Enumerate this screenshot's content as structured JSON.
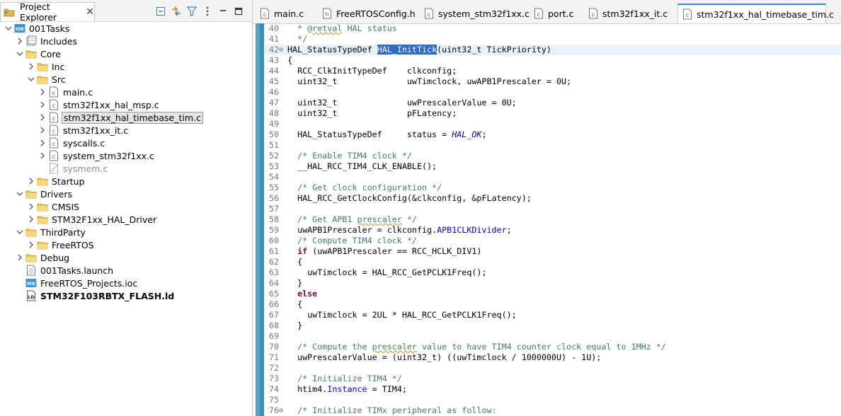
{
  "explorer": {
    "title": "Project Explorer",
    "tree": [
      {
        "label": "001Tasks",
        "depth": 0,
        "chevron": "down",
        "icon": "ide-project-icon"
      },
      {
        "label": "Includes",
        "depth": 1,
        "chevron": "right",
        "icon": "includes-icon"
      },
      {
        "label": "Core",
        "depth": 1,
        "chevron": "down",
        "icon": "folder-icon"
      },
      {
        "label": "Inc",
        "depth": 2,
        "chevron": "right",
        "icon": "folder-icon"
      },
      {
        "label": "Src",
        "depth": 2,
        "chevron": "down",
        "icon": "folder-icon"
      },
      {
        "label": "main.c",
        "depth": 3,
        "chevron": "right",
        "icon": "c-file-icon"
      },
      {
        "label": "stm32f1xx_hal_msp.c",
        "depth": 3,
        "chevron": "right",
        "icon": "c-file-icon"
      },
      {
        "label": "stm32f1xx_hal_timebase_tim.c",
        "depth": 3,
        "chevron": "right",
        "icon": "c-file-icon",
        "selected": true
      },
      {
        "label": "stm32f1xx_it.c",
        "depth": 3,
        "chevron": "right",
        "icon": "c-file-icon"
      },
      {
        "label": "syscalls.c",
        "depth": 3,
        "chevron": "right",
        "icon": "c-file-icon"
      },
      {
        "label": "system_stm32f1xx.c",
        "depth": 3,
        "chevron": "right",
        "icon": "c-file-icon"
      },
      {
        "label": "sysmem.c",
        "depth": 3,
        "chevron": "none",
        "icon": "excluded-c-file-icon",
        "dim": true
      },
      {
        "label": "Startup",
        "depth": 2,
        "chevron": "right",
        "icon": "folder-icon"
      },
      {
        "label": "Drivers",
        "depth": 1,
        "chevron": "down",
        "icon": "folder-icon"
      },
      {
        "label": "CMSIS",
        "depth": 2,
        "chevron": "right",
        "icon": "folder-icon"
      },
      {
        "label": "STM32F1xx_HAL_Driver",
        "depth": 2,
        "chevron": "right",
        "icon": "folder-icon"
      },
      {
        "label": "ThirdParty",
        "depth": 1,
        "chevron": "down",
        "icon": "folder-icon"
      },
      {
        "label": "FreeRTOS",
        "depth": 2,
        "chevron": "right",
        "icon": "folder-icon"
      },
      {
        "label": "Debug",
        "depth": 1,
        "chevron": "right",
        "icon": "folder-icon"
      },
      {
        "label": "001Tasks.launch",
        "depth": 1,
        "chevron": "none",
        "icon": "launch-file-icon"
      },
      {
        "label": "FreeRTOS_Projects.ioc",
        "depth": 1,
        "chevron": "none",
        "icon": "mx-file-icon"
      },
      {
        "label": "STM32F103RBTX_FLASH.ld",
        "depth": 1,
        "chevron": "none",
        "icon": "ld-file-icon",
        "bold": true
      }
    ]
  },
  "editor": {
    "tabs": [
      {
        "label": "main.c",
        "active": false
      },
      {
        "label": "FreeRTOSConfig.h",
        "active": false
      },
      {
        "label": "system_stm32f1xx.c",
        "active": false
      },
      {
        "label": "port.c",
        "active": false
      },
      {
        "label": "stm32f1xx_it.c",
        "active": false
      },
      {
        "label": "stm32f1xx_hal_timebase_tim.c",
        "active": true
      }
    ],
    "lines": [
      {
        "n": "40",
        "segs": [
          [
            "cm",
            "  * @"
          ],
          [
            "cm squig",
            "retval"
          ],
          [
            "cm",
            " HAL status"
          ]
        ]
      },
      {
        "n": "41",
        "segs": [
          [
            "cm",
            "  */"
          ]
        ]
      },
      {
        "n": "42",
        "fold": true,
        "cur": true,
        "segs": [
          [
            "",
            "HAL_StatusTypeDef "
          ],
          [
            "hl",
            "HAL_InitTick"
          ],
          [
            "",
            "(uint32_t TickPriority)"
          ]
        ]
      },
      {
        "n": "43",
        "segs": [
          [
            "",
            "{"
          ]
        ]
      },
      {
        "n": "44",
        "segs": [
          [
            "",
            "  RCC_ClkInitTypeDef    clkconfig;"
          ]
        ]
      },
      {
        "n": "45",
        "segs": [
          [
            "",
            "  uint32_t              uwTimclock, uwAPB1Prescaler = 0U;"
          ]
        ]
      },
      {
        "n": "46",
        "segs": []
      },
      {
        "n": "47",
        "segs": [
          [
            "",
            "  uint32_t              uwPrescalerValue = 0U;"
          ]
        ]
      },
      {
        "n": "48",
        "segs": [
          [
            "",
            "  uint32_t              pFLatency;"
          ]
        ]
      },
      {
        "n": "49",
        "segs": []
      },
      {
        "n": "50",
        "segs": [
          [
            "",
            "  HAL_StatusTypeDef     status = "
          ],
          [
            "it",
            "HAL_OK"
          ],
          [
            "",
            ";"
          ]
        ]
      },
      {
        "n": "51",
        "segs": []
      },
      {
        "n": "52",
        "segs": [
          [
            "cm",
            "  /* Enable TIM4 clock */"
          ]
        ]
      },
      {
        "n": "53",
        "segs": [
          [
            "",
            "  __HAL_RCC_TIM4_CLK_ENABLE();"
          ]
        ]
      },
      {
        "n": "54",
        "segs": []
      },
      {
        "n": "55",
        "segs": [
          [
            "cm",
            "  /* Get clock configuration */"
          ]
        ]
      },
      {
        "n": "56",
        "segs": [
          [
            "",
            "  HAL_RCC_GetClockConfig(&clkconfig, &pFLatency);"
          ]
        ]
      },
      {
        "n": "57",
        "segs": []
      },
      {
        "n": "58",
        "segs": [
          [
            "cm",
            "  /* Get APB1 "
          ],
          [
            "cm squig",
            "prescaler"
          ],
          [
            "cm",
            " */"
          ]
        ]
      },
      {
        "n": "59",
        "segs": [
          [
            "",
            "  uwAPB1Prescaler = clkconfig."
          ],
          [
            "fld",
            "APB1CLKDivider"
          ],
          [
            "",
            ";"
          ]
        ]
      },
      {
        "n": "60",
        "segs": [
          [
            "cm",
            "  /* Compute TIM4 clock */"
          ]
        ]
      },
      {
        "n": "61",
        "segs": [
          [
            "kw",
            "  if"
          ],
          [
            "",
            " (uwAPB1Prescaler == RCC_HCLK_DIV1)"
          ]
        ]
      },
      {
        "n": "62",
        "segs": [
          [
            "",
            "  {"
          ]
        ]
      },
      {
        "n": "63",
        "segs": [
          [
            "",
            "    uwTimclock = HAL_RCC_GetPCLK1Freq();"
          ]
        ]
      },
      {
        "n": "64",
        "segs": [
          [
            "",
            "  }"
          ]
        ]
      },
      {
        "n": "65",
        "segs": [
          [
            "kw",
            "  else"
          ]
        ]
      },
      {
        "n": "66",
        "segs": [
          [
            "",
            "  {"
          ]
        ]
      },
      {
        "n": "67",
        "segs": [
          [
            "",
            "    uwTimclock = 2UL * HAL_RCC_GetPCLK1Freq();"
          ]
        ]
      },
      {
        "n": "68",
        "segs": [
          [
            "",
            "  }"
          ]
        ]
      },
      {
        "n": "69",
        "segs": []
      },
      {
        "n": "70",
        "segs": [
          [
            "cm",
            "  /* Compute the "
          ],
          [
            "cm squig",
            "prescaler"
          ],
          [
            "cm",
            " value to have TIM4 counter clock equal to 1MHz */"
          ]
        ]
      },
      {
        "n": "71",
        "segs": [
          [
            "",
            "  uwPrescalerValue = (uint32_t) ((uwTimclock / 1000000U) - 1U);"
          ]
        ]
      },
      {
        "n": "72",
        "segs": []
      },
      {
        "n": "73",
        "segs": [
          [
            "cm",
            "  /* Initialize TIM4 */"
          ]
        ]
      },
      {
        "n": "74",
        "segs": [
          [
            "",
            "  htim4."
          ],
          [
            "fld",
            "Instance"
          ],
          [
            "",
            " = TIM4;"
          ]
        ]
      },
      {
        "n": "75",
        "segs": []
      },
      {
        "n": "76",
        "fold": true,
        "segs": [
          [
            "cm",
            "  /* Initialize TIMx peripheral as follow:"
          ]
        ]
      }
    ]
  }
}
